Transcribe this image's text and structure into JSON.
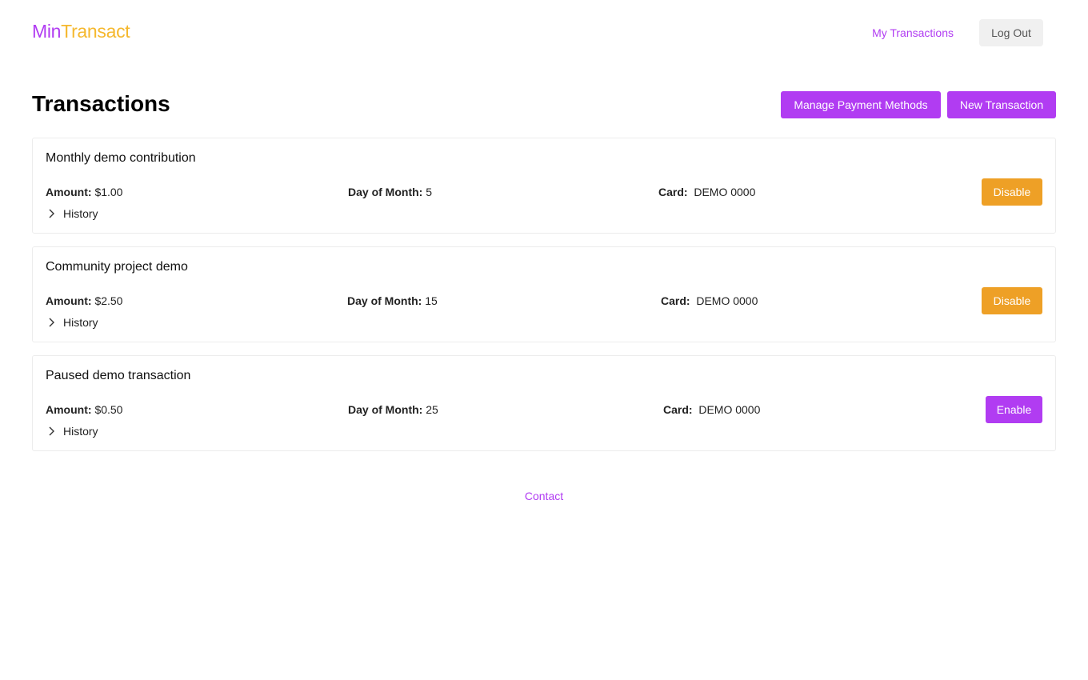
{
  "brand": {
    "part1": "Min",
    "part2": "Transact",
    "color1": "#b13cf2",
    "color2": "#f5b82e"
  },
  "nav": {
    "my_transactions": "My Transactions",
    "logout": "Log Out"
  },
  "page": {
    "title": "Transactions",
    "manage_label": "Manage Payment Methods",
    "new_label": "New Transaction"
  },
  "labels": {
    "amount": "Amount:",
    "day": "Day of Month:",
    "card": "Card:",
    "history": "History"
  },
  "transactions": [
    {
      "name": "Monthly demo contribution",
      "amount": "$1.00",
      "day": "5",
      "card": "DEMO 0000",
      "action": "Disable"
    },
    {
      "name": "Community project demo",
      "amount": "$2.50",
      "day": "15",
      "card": "DEMO 0000",
      "action": "Disable"
    },
    {
      "name": "Paused demo transaction",
      "amount": "$0.50",
      "day": "25",
      "card": "DEMO 0000",
      "action": "Enable"
    }
  ],
  "footer": {
    "contact": "Contact"
  },
  "icons": {
    "history_toggle": "chevron-right-icon"
  }
}
